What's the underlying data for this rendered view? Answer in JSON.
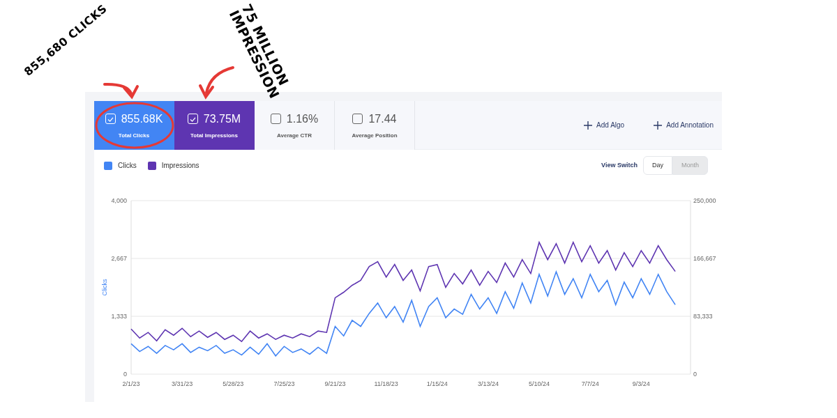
{
  "overlay_notes": [
    {
      "text": "855,680 CLICKS"
    },
    {
      "text": "75 MILLION\nIMPRESSION"
    }
  ],
  "metrics": [
    {
      "value": "855.68K",
      "label": "Total Clicks",
      "checked": true,
      "color": "#4285f4"
    },
    {
      "value": "73.75M",
      "label": "Total Impressions",
      "checked": true,
      "color": "#5e35b1"
    },
    {
      "value": "1.16%",
      "label": "Average CTR",
      "checked": false
    },
    {
      "value": "17.44",
      "label": "Average Position",
      "checked": false
    }
  ],
  "actions": [
    {
      "label": "Add Algo"
    },
    {
      "label": "Add Annotation"
    }
  ],
  "view_switch": {
    "label": "View Switch",
    "options": [
      {
        "label": "Day",
        "selected": true
      },
      {
        "label": "Month",
        "selected": false
      }
    ]
  },
  "chart": {
    "chart_data": {
      "type": "line",
      "ylabel": "Clicks",
      "categories": [
        "2/1/23",
        null,
        null,
        null,
        null,
        null,
        "3/31/23",
        null,
        null,
        null,
        null,
        null,
        "5/28/23",
        null,
        null,
        null,
        null,
        null,
        "7/25/23",
        null,
        null,
        null,
        null,
        null,
        "9/21/23",
        null,
        null,
        null,
        null,
        null,
        "11/18/23",
        null,
        null,
        null,
        null,
        null,
        "1/15/24",
        null,
        null,
        null,
        null,
        null,
        "3/13/24",
        null,
        null,
        null,
        null,
        null,
        "5/10/24",
        null,
        null,
        null,
        null,
        null,
        "7/7/24",
        null,
        null,
        null,
        null,
        null,
        "9/3/24",
        null,
        null,
        null,
        null
      ],
      "series": [
        {
          "name": "Clicks",
          "color": "#4285f4",
          "values": [
            700,
            520,
            640,
            480,
            660,
            560,
            700,
            500,
            620,
            540,
            660,
            480,
            560,
            440,
            620,
            460,
            700,
            420,
            640,
            500,
            580,
            460,
            620,
            480,
            1100,
            880,
            1240,
            1100,
            1400,
            1640,
            1300,
            1560,
            1200,
            1700,
            1100,
            1560,
            1760,
            1300,
            1500,
            1380,
            1840,
            1500,
            1760,
            1400,
            1900,
            1520,
            2100,
            1640,
            2300,
            1800,
            2360,
            1840,
            2200,
            1760,
            2300,
            1900,
            2160,
            1600,
            2120,
            1760,
            2200,
            1840,
            2300,
            1900,
            1600
          ]
        },
        {
          "name": "Impressions",
          "color": "#5e35b1",
          "axis": "y2",
          "values": [
            65000,
            52000,
            60000,
            48000,
            64000,
            56000,
            66000,
            54000,
            62000,
            53000,
            60000,
            50000,
            56000,
            47000,
            62000,
            52000,
            58000,
            50000,
            56000,
            52000,
            58000,
            54000,
            62000,
            60000,
            110000,
            118000,
            128000,
            135000,
            155000,
            162000,
            140000,
            158000,
            135000,
            150000,
            120000,
            155000,
            158000,
            125000,
            145000,
            130000,
            150000,
            128000,
            148000,
            132000,
            160000,
            140000,
            165000,
            145000,
            190000,
            165000,
            188000,
            160000,
            190000,
            162000,
            185000,
            160000,
            178000,
            150000,
            175000,
            155000,
            178000,
            160000,
            185000,
            165000,
            148000
          ]
        }
      ],
      "ylim": [
        0,
        4000
      ],
      "y2lim": [
        0,
        250000
      ],
      "yticks": [
        {
          "value": 0,
          "label": "0"
        },
        {
          "value": 1333,
          "label": "1,333"
        },
        {
          "value": 2667,
          "label": "2,667"
        },
        {
          "value": 4000,
          "label": "4,000"
        }
      ],
      "y2ticks": [
        {
          "value": 0,
          "label": "0"
        },
        {
          "value": 83333,
          "label": "83,333"
        },
        {
          "value": 166667,
          "label": "166,667"
        },
        {
          "value": 250000,
          "label": "250,000"
        }
      ]
    }
  }
}
